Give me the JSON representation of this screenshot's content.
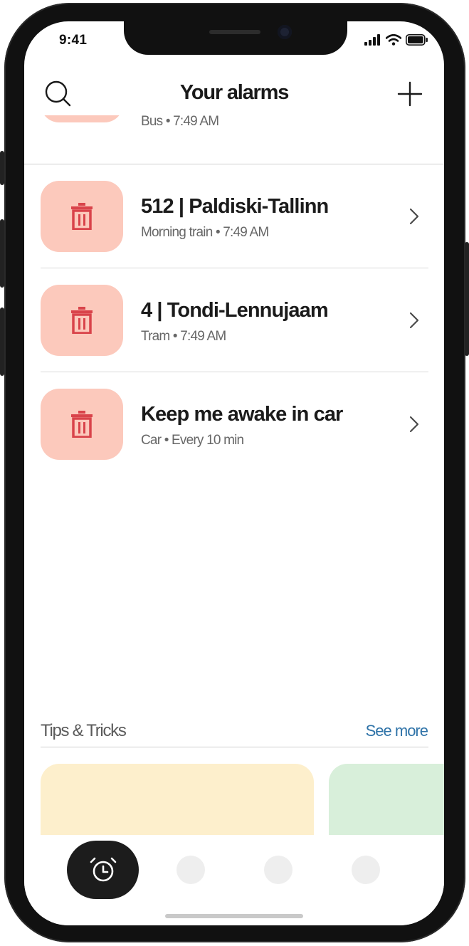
{
  "status_bar": {
    "time": "9:41"
  },
  "header": {
    "title": "Your alarms"
  },
  "alarms": [
    {
      "title": "",
      "subtitle": "Bus • 7:49 AM"
    },
    {
      "title": "512 | Paldiski-Tallinn",
      "subtitle": "Morning train • 7:49 AM"
    },
    {
      "title": "4 | Tondi-Lennujaam",
      "subtitle": "Tram • 7:49 AM"
    },
    {
      "title": "Keep me awake in car",
      "subtitle": "Car • Every 10 min"
    }
  ],
  "tips": {
    "title": "Tips & Tricks",
    "see_more": "See more"
  },
  "colors": {
    "delete_bg": "#fcc9bc",
    "delete_icon": "#d9434a",
    "link": "#2f73a8",
    "tip_card_1": "#fdefcc",
    "tip_card_2": "#d8efda",
    "tab_active": "#1c1c1c"
  },
  "icons": {
    "search": "search-icon",
    "add": "plus-icon",
    "delete": "trash-icon",
    "chevron": "chevron-right-icon",
    "tab_alarm": "alarm-clock-icon"
  }
}
